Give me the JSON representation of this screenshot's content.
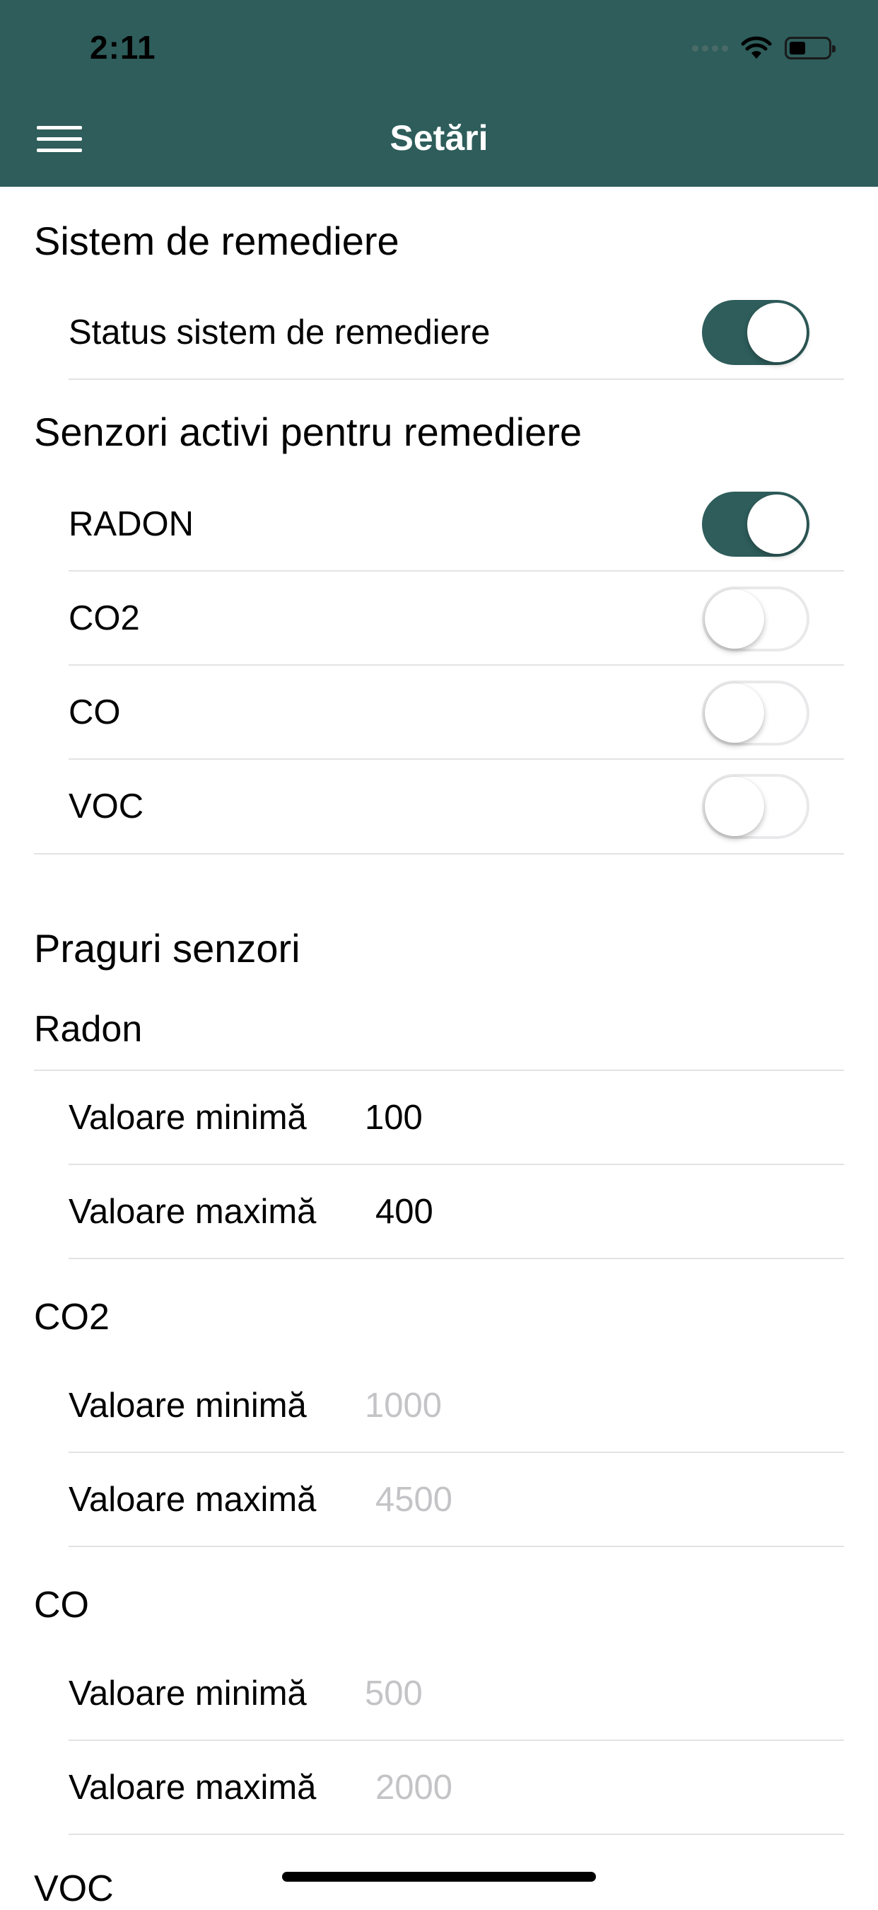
{
  "status_bar": {
    "time": "2:11"
  },
  "header": {
    "title": "Setări"
  },
  "remediation": {
    "heading": "Sistem de remediere",
    "status_label": "Status sistem de remediere",
    "status_on": true
  },
  "active_sensors": {
    "heading": "Senzori activi pentru remediere",
    "items": [
      {
        "label": "RADON",
        "on": true
      },
      {
        "label": "CO2",
        "on": false
      },
      {
        "label": "CO",
        "on": false
      },
      {
        "label": "VOC",
        "on": false
      }
    ]
  },
  "thresholds": {
    "heading": "Praguri senzori",
    "groups": [
      {
        "name": "Radon",
        "min_label": "Valoare minimă",
        "min_value": "100",
        "max_label": "Valoare maximă",
        "max_value": "400"
      },
      {
        "name": "CO2",
        "min_label": "Valoare minimă",
        "min_placeholder": "1000",
        "max_label": "Valoare maximă",
        "max_placeholder": "4500"
      },
      {
        "name": "CO",
        "min_label": "Valoare minimă",
        "min_placeholder": "500",
        "max_label": "Valoare maximă",
        "max_placeholder": "2000"
      },
      {
        "name": "VOC"
      }
    ]
  }
}
